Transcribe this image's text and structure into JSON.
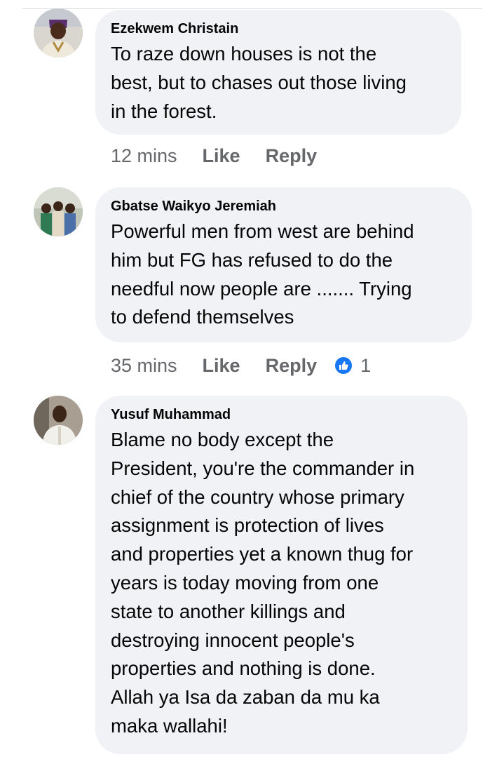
{
  "comments": [
    {
      "author": "Ezekwem Christain",
      "lines": [
        "To raze down houses is not the",
        "best, but to chases out those living",
        "in the forest."
      ],
      "time": "12 mins",
      "like_label": "Like",
      "reply_label": "Reply"
    },
    {
      "author": "Gbatse Waikyo Jeremiah",
      "lines": [
        "Powerful men from west are behind",
        "him but FG has refused to do the",
        "needful now people are ....... Trying",
        "to defend themselves"
      ],
      "time": "35 mins",
      "like_label": "Like",
      "reply_label": "Reply",
      "reaction_icon": "like-icon",
      "reaction_count": "1"
    },
    {
      "author": "Yusuf Muhammad",
      "lines": [
        "Blame no body except the",
        "President, you're the commander in",
        "chief of the country whose primary",
        "assignment is protection of lives",
        "and properties yet a known thug for",
        "years is today moving from one",
        "state to another killings and",
        "destroying innocent people's",
        "properties and nothing is done.",
        "Allah ya Isa da zaban da mu ka",
        "maka wallahi!"
      ]
    }
  ],
  "colors": {
    "bubble": "#f0f2f5",
    "meta_text": "#65676b",
    "like_blue": "#1877f2"
  }
}
